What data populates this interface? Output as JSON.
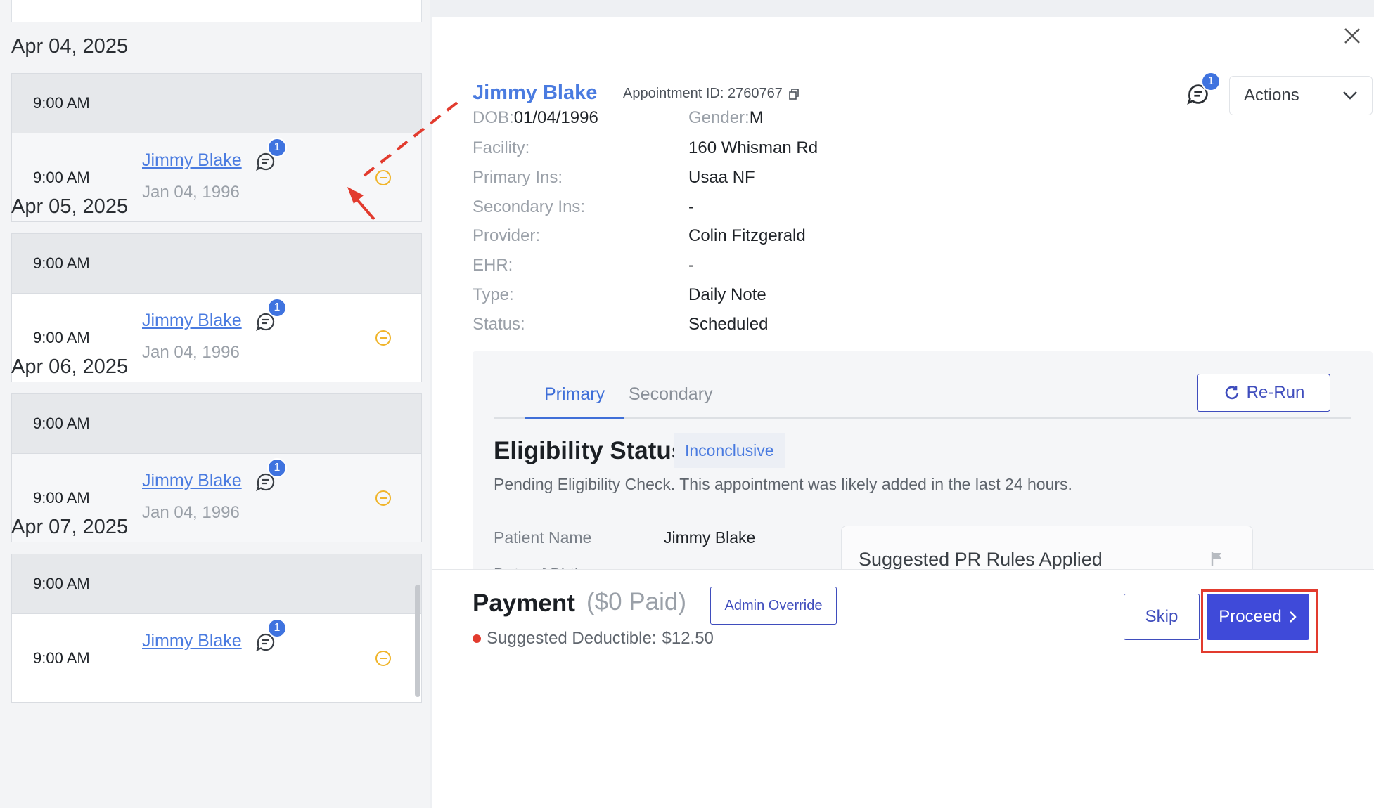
{
  "left_list": {
    "groups": [
      {
        "date": "Apr 04, 2025",
        "header_time": "9:00 AM",
        "row_time": "9:00 AM",
        "name": "Jimmy Blake",
        "dob": "Jan 04, 1996",
        "badge": "1"
      },
      {
        "date": "Apr 05, 2025",
        "header_time": "9:00 AM",
        "row_time": "9:00 AM",
        "name": "Jimmy Blake",
        "dob": "Jan 04, 1996",
        "badge": "1"
      },
      {
        "date": "Apr 06, 2025",
        "header_time": "9:00 AM",
        "row_time": "9:00 AM",
        "name": "Jimmy Blake",
        "dob": "Jan 04, 1996",
        "badge": "1"
      },
      {
        "date": "Apr 07, 2025",
        "header_time": "9:00 AM",
        "row_time": "9:00 AM",
        "name": "Jimmy Blake",
        "dob": "",
        "badge": "1"
      }
    ]
  },
  "panel": {
    "patient_name": "Jimmy Blake",
    "appointment_id": "Appointment ID: 2760767",
    "header_badge": "1",
    "actions_label": "Actions",
    "dob_label": "DOB:",
    "dob_value": "01/04/1996",
    "gender_label": "Gender:",
    "gender_value": "M",
    "details": [
      {
        "label": "Facility:",
        "value": "160 Whisman Rd"
      },
      {
        "label": "Primary Ins:",
        "value": "Usaa NF"
      },
      {
        "label": "Secondary Ins:",
        "value": "-"
      },
      {
        "label": "Provider:",
        "value": "Colin Fitzgerald"
      },
      {
        "label": "EHR:",
        "value": "-"
      },
      {
        "label": "Type:",
        "value": "Daily Note"
      },
      {
        "label": "Status:",
        "value": "Scheduled"
      }
    ]
  },
  "eligibility": {
    "tab_primary": "Primary",
    "tab_secondary": "Secondary",
    "rerun_label": "Re-Run",
    "title": "Eligibility Status:",
    "status": "Inconclusive",
    "message": "Pending Eligibility Check. This appointment was likely added in the last 24 hours.",
    "patient_name_label": "Patient Name",
    "patient_name_value": "Jimmy Blake",
    "dob_label_partial": "Date of Birth",
    "pr_rules_title": "Suggested PR Rules Applied"
  },
  "footer": {
    "payment_title": "Payment",
    "payment_paid": "($0 Paid)",
    "admin_override": "Admin Override",
    "deductible_label": "Suggested Deductible:",
    "deductible_value": "$12.50",
    "skip_label": "Skip",
    "proceed_label": "Proceed"
  },
  "colors": {
    "link_blue": "#4a7be0",
    "primary_button": "#3f4ad9",
    "annotation_red": "#e23b2e",
    "pending_orange": "#f0b429"
  }
}
